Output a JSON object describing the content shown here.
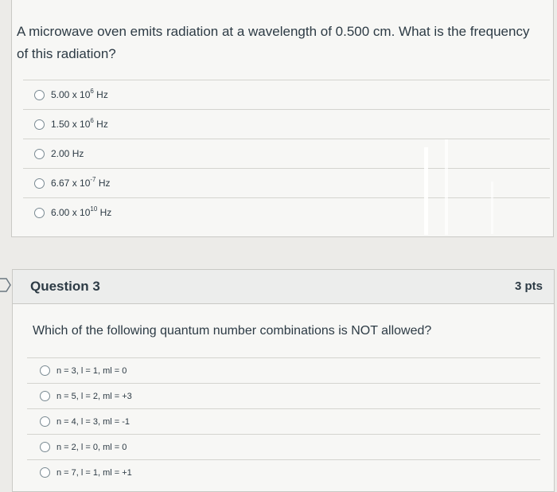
{
  "question2": {
    "text": "A microwave oven emits radiation at a wavelength of 0.500 cm. What is the frequency of this radiation?",
    "answers": [
      {
        "base": "5.00 x 10",
        "exp": "6",
        "unit": " Hz"
      },
      {
        "base": "1.50 x 10",
        "exp": "6",
        "unit": " Hz"
      },
      {
        "base": "2.00 Hz",
        "exp": "",
        "unit": ""
      },
      {
        "base": "6.67 x 10",
        "exp": "-7",
        "unit": " Hz"
      },
      {
        "base": "6.00 x 10",
        "exp": "10",
        "unit": " Hz"
      }
    ]
  },
  "question3": {
    "title": "Question 3",
    "points": "3 pts",
    "text": "Which of the following quantum number combinations is NOT allowed?",
    "answers": [
      "n = 3, l = 1, ml = 0",
      "n = 5, l = 2, ml = +3",
      "n = 4, l = 3, ml = -1",
      "n = 2, l = 0, ml = 0",
      "n = 7, l = 1, ml = +1"
    ]
  }
}
